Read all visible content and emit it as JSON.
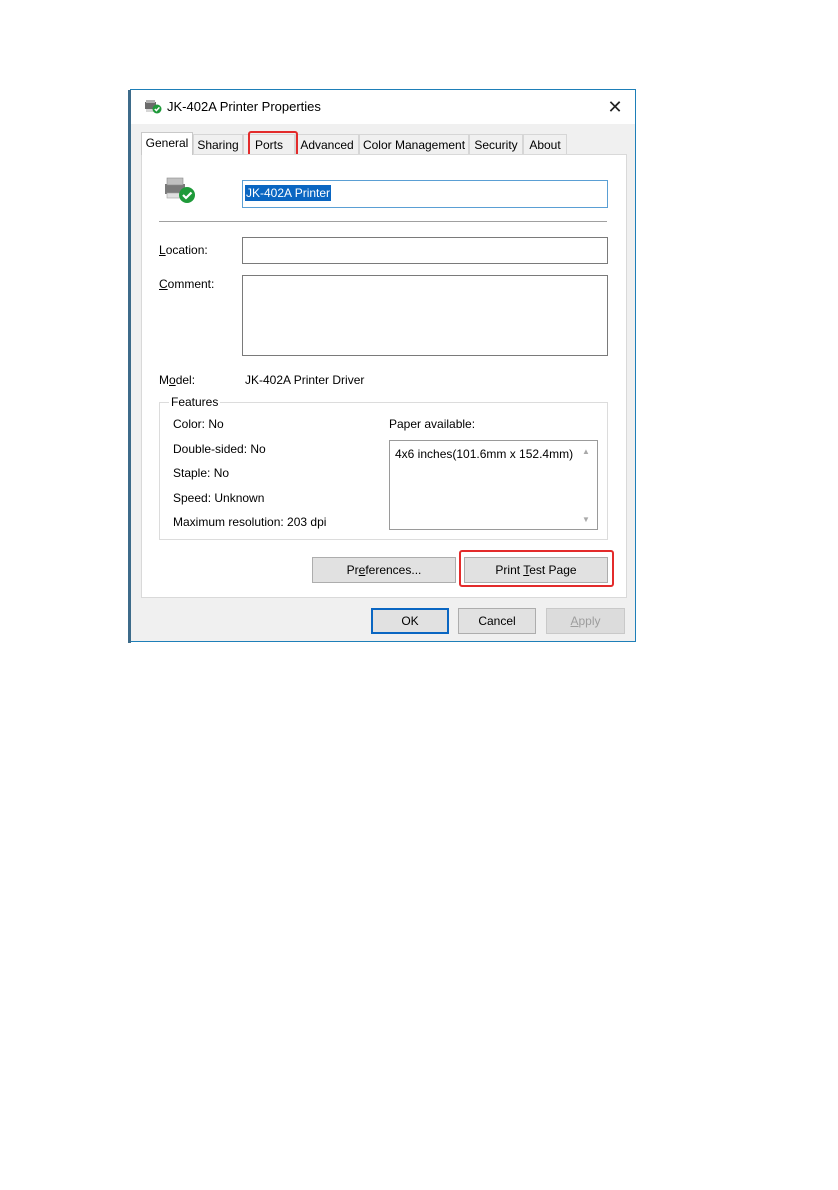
{
  "window": {
    "title": "JK-402A Printer Properties",
    "close_glyph": "✕"
  },
  "tabs": [
    {
      "label": "General",
      "active": true
    },
    {
      "label": "Sharing"
    },
    {
      "label": "Ports",
      "highlighted": true
    },
    {
      "label": "Advanced"
    },
    {
      "label": "Color Management"
    },
    {
      "label": "Security"
    },
    {
      "label": "About"
    }
  ],
  "general": {
    "printer_name": "JK-402A Printer",
    "location_label_u": "L",
    "location_label_rest": "ocation:",
    "location_value": "",
    "comment_label_u": "C",
    "comment_label_rest": "omment:",
    "comment_value": "",
    "model_label_pre": "M",
    "model_label_u": "o",
    "model_label_rest": "del:",
    "model_value": "JK-402A Printer Driver"
  },
  "features": {
    "legend": "Features",
    "color": "Color: No",
    "double_sided": "Double-sided: No",
    "staple": "Staple: No",
    "speed": "Speed: Unknown",
    "max_resolution": "Maximum resolution: 203 dpi",
    "paper_label": "Paper available:",
    "paper_items": [
      "4x6 inches(101.6mm x 152.4mm)"
    ]
  },
  "buttons": {
    "preferences_pre": "Pr",
    "preferences_u": "e",
    "preferences_rest": "ferences...",
    "print_test_pre": "Print ",
    "print_test_u": "T",
    "print_test_rest": "est Page",
    "ok": "OK",
    "cancel": "Cancel",
    "apply_u": "A",
    "apply_rest": "pply"
  },
  "colors": {
    "highlight": "#e32b2b",
    "accent": "#0a66c2",
    "check_green": "#1f9a3a"
  },
  "icons": {
    "printer": "printer-check-icon",
    "close": "close-icon",
    "scroll_up": "chevron-up-icon",
    "scroll_down": "chevron-down-icon"
  }
}
